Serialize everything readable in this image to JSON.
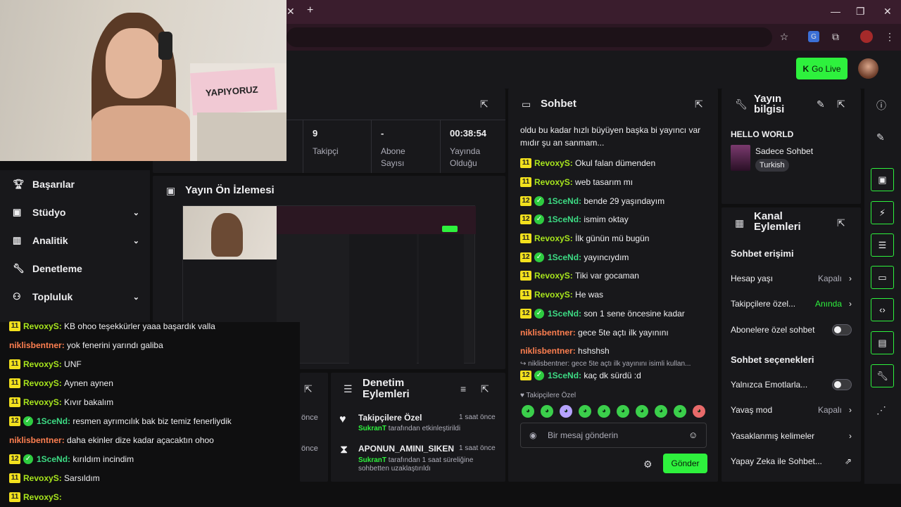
{
  "stats": [
    {
      "value": "9",
      "label": "Takipçi"
    },
    {
      "value": "-",
      "label": "Abone Sayısı"
    },
    {
      "value": "00:38:54",
      "label": "Yayında Olduğu"
    }
  ],
  "go_live": "Go Live",
  "nav": [
    {
      "label": "Başarılar",
      "icon": "trophy-icon"
    },
    {
      "label": "Stüdyo",
      "icon": "camera-icon"
    },
    {
      "label": "Analitik",
      "icon": "chart-icon"
    },
    {
      "label": "Denetleme",
      "icon": "wrench-icon"
    },
    {
      "label": "Topluluk",
      "icon": "community-icon"
    }
  ],
  "preview_title": "Yayın Ön İzlemesi",
  "webcam_sign": "YAPIYORUZ",
  "left_chat": [
    {
      "badge": "11",
      "user": "RevoxyS",
      "text": "KB ohoo teşekkürler yaaa başardık valla",
      "cls": "uy"
    },
    {
      "badge": "",
      "user": "niklisbentner",
      "text": "yok fenerini yarındı galiba",
      "cls": "ut"
    },
    {
      "badge": "11",
      "user": "RevoxyS",
      "text": "UNF",
      "cls": "uy"
    },
    {
      "badge": "11",
      "user": "RevoxyS",
      "text": "Aynen aynen",
      "cls": "uy"
    },
    {
      "badge": "11",
      "user": "RevoxyS",
      "text": "Kıvır bakalım",
      "cls": "uy"
    },
    {
      "badge": "12",
      "user": "1SceNd",
      "text": "resmen ayrımcılık bak biz temiz fenerliydik",
      "cls": "uc",
      "verified": true
    },
    {
      "badge": "",
      "user": "niklisbentner",
      "text": "daha ekinler dize kadar açacaktın ohoo",
      "cls": "ut"
    },
    {
      "badge": "12",
      "user": "1SceNd",
      "text": "kırıldım incindim",
      "cls": "uc",
      "verified": true
    },
    {
      "badge": "11",
      "user": "RevoxyS",
      "text": "Sarsıldım",
      "cls": "uy"
    },
    {
      "badge": "11",
      "user": "RevoxyS",
      "text": "",
      "cls": "uy"
    }
  ],
  "mod_title": "Denetim Eylemleri",
  "mod_actions": [
    {
      "title": "Takipçilere Özel",
      "time": "1 saat önce",
      "user": "SukranT",
      "desc": "tarafından etkinleştirildi",
      "icon": "heart-icon"
    },
    {
      "title": "APONUN_AMINI_SIKEN",
      "time": "1 saat önce",
      "user": "SukranT",
      "desc": "tarafından 1 saat süreliğine sohbetten uzaklaştırıldı",
      "icon": "hourglass-icon"
    }
  ],
  "partial_time": "önce",
  "chat_title": "Sohbet",
  "chat_intro": "oldu bu kadar hızlı büyüyen başka bi yayıncı var mıdır şu an sanmam...",
  "chat": [
    {
      "badge": "11",
      "user": "RevoxyS",
      "text": "Okul falan dümenden",
      "cls": "uy"
    },
    {
      "badge": "11",
      "user": "RevoxyS",
      "text": "web tasarım mı",
      "cls": "uy"
    },
    {
      "badge": "12",
      "user": "1SceNd",
      "text": "bende 29 yaşındayım",
      "cls": "uc",
      "verified": true
    },
    {
      "badge": "12",
      "user": "1SceNd",
      "text": "ismim oktay",
      "cls": "uc",
      "verified": true
    },
    {
      "badge": "11",
      "user": "RevoxyS",
      "text": "İlk günün mü bugün",
      "cls": "uy"
    },
    {
      "badge": "12",
      "user": "1SceNd",
      "text": "yayıncıydım",
      "cls": "uc",
      "verified": true
    },
    {
      "badge": "11",
      "user": "RevoxyS",
      "text": "Tiki var gocaman",
      "cls": "uy"
    },
    {
      "badge": "11",
      "user": "RevoxyS",
      "text": "He was",
      "cls": "uy"
    },
    {
      "badge": "12",
      "user": "1SceNd",
      "text": "son 1 sene öncesine kadar",
      "cls": "uc",
      "verified": true
    },
    {
      "badge": "",
      "user": "niklisbentner",
      "text": "gece 5te açtı ilk yayınını",
      "cls": "ut"
    },
    {
      "badge": "",
      "user": "niklisbentner",
      "text": "hshshsh",
      "cls": "ut"
    }
  ],
  "reply_ref": "niklisbentner: gece 5te açtı ilk yayınını isimli kullan...",
  "reply_line": {
    "badge": "12",
    "user": "1SceNd",
    "text": "kaç dk sürdü :d"
  },
  "follower_only": "Takipçilere Özel",
  "chat_placeholder": "Bir mesaj gönderin",
  "send_label": "Gönder",
  "info_title": "Yayın bilgisi",
  "stream_title": "HELLO WORLD",
  "category": "Sadece Sohbet",
  "language": "Turkish",
  "channel_title": "Kanal Eylemleri",
  "chat_access_heading": "Sohbet erişimi",
  "account_age": {
    "label": "Hesap yaşı",
    "value": "Kapalı"
  },
  "followers_only": {
    "label": "Takipçilere özel...",
    "value": "Anında"
  },
  "subs_only": {
    "label": "Abonelere özel sohbet"
  },
  "chat_options_heading": "Sohbet seçenekleri",
  "emotes_only": {
    "label": "Yalnızca Emotlarla..."
  },
  "slow_mode": {
    "label": "Yavaş mod",
    "value": "Kapalı"
  },
  "banned_words": {
    "label": "Yasaklanmış kelimeler"
  },
  "ai_mod": {
    "label": "Yapay Zeka ile Sohbet..."
  },
  "colors": {
    "accent": "#2ef13d",
    "bg": "#0f0f10",
    "panel": "#18181b"
  }
}
